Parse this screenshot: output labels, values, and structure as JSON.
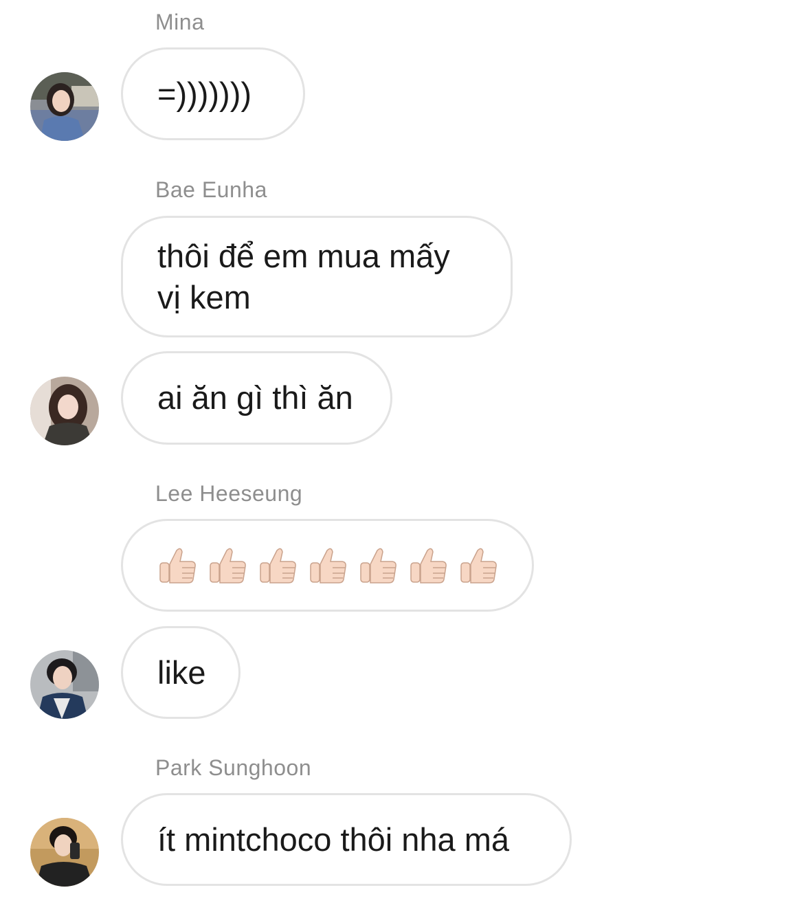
{
  "messages": [
    {
      "sender": "Mina",
      "text": "=)))))))",
      "avatar": "avatar-mina"
    },
    {
      "sender": "Bae Eunha",
      "text": "thôi để em mua mấy\nvị kem"
    },
    {
      "text": "ai ăn gì thì ăn",
      "avatar": "avatar-bae-eunha"
    },
    {
      "sender": "Lee Heeseung",
      "emoji": "thumbs-up-light-skin-tone",
      "emoji_count": 7
    },
    {
      "text": "like",
      "avatar": "avatar-lee-heeseung"
    },
    {
      "sender": "Park Sunghoon",
      "text": "ít mintchoco thôi nha má",
      "avatar": "avatar-park-sunghoon"
    }
  ],
  "colors": {
    "bubble_border": "#e3e3e3",
    "sender_name": "#8e8e8e",
    "message_text": "#1a1a1a",
    "thumb_skin": "#f7d7c4"
  }
}
